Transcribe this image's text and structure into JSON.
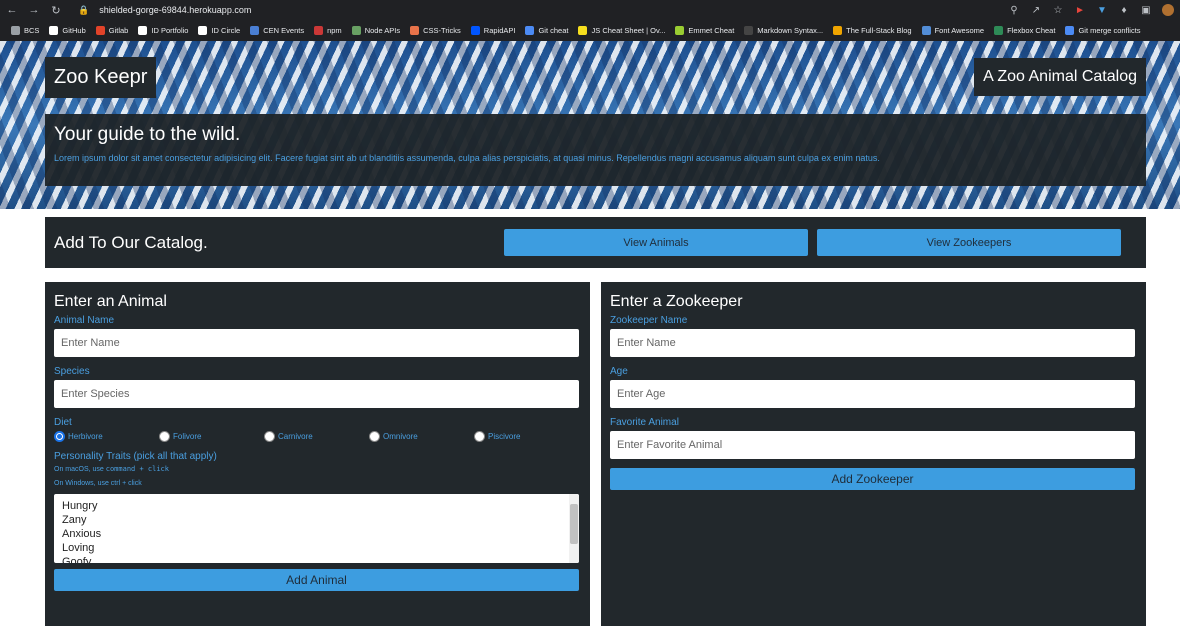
{
  "browser": {
    "url": "shielded-gorge-69844.herokuapp.com",
    "bookmarks": [
      {
        "label": "BCS",
        "color": "#9aa0a6"
      },
      {
        "label": "GitHub",
        "color": "#ffffff"
      },
      {
        "label": "Gitlab",
        "color": "#e24329"
      },
      {
        "label": "ID Portfolio",
        "color": "#ffffff"
      },
      {
        "label": "ID Circle",
        "color": "#ffffff"
      },
      {
        "label": "CEN Events",
        "color": "#4a7fd4"
      },
      {
        "label": "npm",
        "color": "#cb3837"
      },
      {
        "label": "Node APIs",
        "color": "#68a063"
      },
      {
        "label": "CSS-Tricks",
        "color": "#e8734a"
      },
      {
        "label": "RapidAPI",
        "color": "#0055ff"
      },
      {
        "label": "Git cheat",
        "color": "#4c8bf5"
      },
      {
        "label": "JS Cheat Sheet | Ov...",
        "color": "#f7df1e"
      },
      {
        "label": "Emmet Cheat",
        "color": "#9acd32"
      },
      {
        "label": "Markdown Syntax...",
        "color": "#444444"
      },
      {
        "label": "The Full-Stack Blog",
        "color": "#f0a500"
      },
      {
        "label": "Font Awesome",
        "color": "#528dd7"
      },
      {
        "label": "Flexbox Cheat",
        "color": "#2e8b57"
      },
      {
        "label": "Git merge conflicts",
        "color": "#4c8bf5"
      }
    ]
  },
  "header": {
    "brand": "Zoo Keepr",
    "tagline": "A Zoo Animal Catalog",
    "guide_title": "Your guide to the wild.",
    "guide_text": "Lorem ipsum dolor sit amet consectetur adipisicing elit. Facere fugiat sint ab ut blanditiis assumenda, culpa alias perspiciatis, at quasi minus. Repellendus magni accusamus aliquam sunt culpa ex enim natus."
  },
  "catalog": {
    "title": "Add To Our Catalog.",
    "view_animals": "View Animals",
    "view_zookeepers": "View Zookeepers"
  },
  "animal_form": {
    "title": "Enter an Animal",
    "name_label": "Animal Name",
    "name_placeholder": "Enter Name",
    "species_label": "Species",
    "species_placeholder": "Enter Species",
    "diet_label": "Diet",
    "diets": [
      "Herbivore",
      "Folivore",
      "Carnivore",
      "Omnivore",
      "Piscivore"
    ],
    "selected_diet": "Herbivore",
    "traits_label": "Personality Traits (pick all that apply)",
    "hint_mac_prefix": "On macOS, use ",
    "hint_mac_keys": "command + click",
    "hint_win": "On Windows, use ctrl + click",
    "traits": [
      "Hungry",
      "Zany",
      "Anxious",
      "Loving",
      "Goofy"
    ],
    "submit": "Add Animal"
  },
  "zookeeper_form": {
    "title": "Enter a Zookeeper",
    "name_label": "Zookeeper Name",
    "name_placeholder": "Enter Name",
    "age_label": "Age",
    "age_placeholder": "Enter Age",
    "fav_label": "Favorite Animal",
    "fav_placeholder": "Enter Favorite Animal",
    "submit": "Add Zookeeper"
  }
}
